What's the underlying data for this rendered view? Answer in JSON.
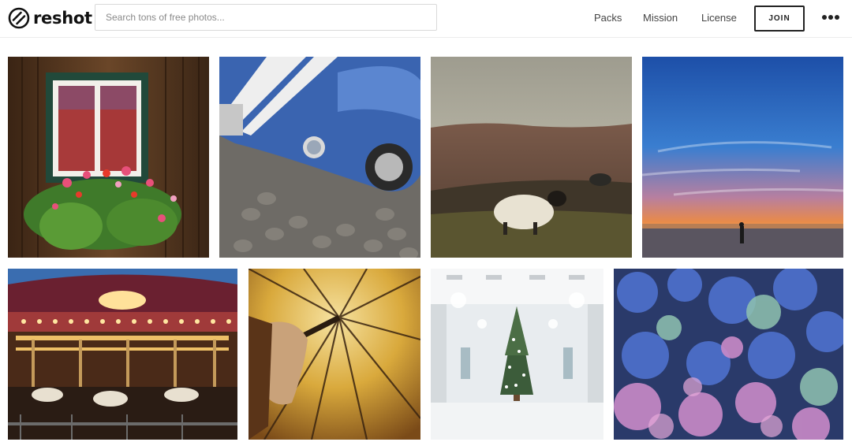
{
  "header": {
    "logo_text": "reshot",
    "search_placeholder": "Search tons of free photos...",
    "nav": {
      "packs": "Packs",
      "mission": "Mission",
      "license": "License"
    },
    "join_label": "JOIN",
    "more_icon": "ellipsis-icon"
  },
  "photos": [
    {
      "name": "photo-window-flowers",
      "subject": "rustic wooden wall with window and flower box"
    },
    {
      "name": "photo-blue-car",
      "subject": "blue vintage sports car on cobblestones"
    },
    {
      "name": "photo-sheep",
      "subject": "sheep in hilly field"
    },
    {
      "name": "photo-sunset-beach",
      "subject": "sunset over beach with person"
    },
    {
      "name": "photo-carousel",
      "subject": "illuminated carousel"
    },
    {
      "name": "photo-umbrella",
      "subject": "hand holding umbrella from inside"
    },
    {
      "name": "photo-christmas-tree",
      "subject": "christmas tree in white hall"
    },
    {
      "name": "photo-hydrangea",
      "subject": "blue and purple hydrangea flowers"
    }
  ],
  "colors": {
    "text": "#444444",
    "border": "#d9d9d9",
    "join_border": "#222222"
  }
}
